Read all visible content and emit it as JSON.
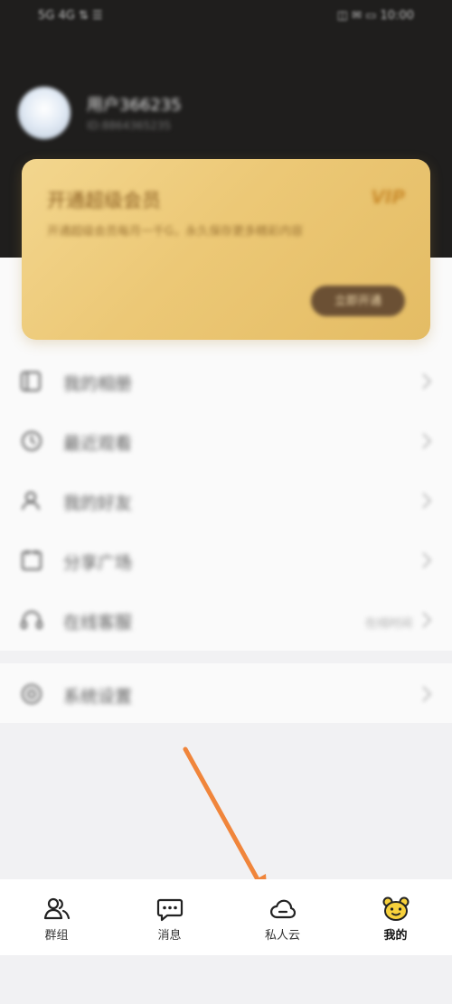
{
  "status_bar": {
    "left": "5G 4G ⇅ ☰",
    "right": "◫ ✉ ▭ 10:00"
  },
  "profile": {
    "name": "用户366235",
    "id": "ID:8864365235"
  },
  "vip_card": {
    "title": "开通超级会员",
    "badge": "VIP",
    "description": "开通超级会员每月一千G，永久保存更多精彩内容",
    "button_label": "立即开通"
  },
  "menu": {
    "items": [
      {
        "label": "我的相册",
        "icon": "album-icon"
      },
      {
        "label": "最近观看",
        "icon": "recent-icon"
      },
      {
        "label": "我的好友",
        "icon": "friends-icon"
      },
      {
        "label": "分享广场",
        "icon": "share-square-icon"
      },
      {
        "label": "在线客服",
        "icon": "headset-icon",
        "extra": "在线时间"
      }
    ],
    "settings": {
      "label": "系统设置",
      "icon": "settings-icon"
    }
  },
  "tabbar": {
    "tabs": [
      {
        "label": "群组",
        "icon": "group-icon",
        "active": false
      },
      {
        "label": "消息",
        "icon": "message-icon",
        "active": false
      },
      {
        "label": "私人云",
        "icon": "cloud-icon",
        "active": false
      },
      {
        "label": "我的",
        "icon": "bear-face-icon",
        "active": true
      }
    ]
  },
  "colors": {
    "header_bg": "#1f1e1d",
    "vip_gold": "#ecc876",
    "vip_button": "#6b5034",
    "active_tab_icon": "#f7d13c",
    "arrow": "#f0853b"
  }
}
